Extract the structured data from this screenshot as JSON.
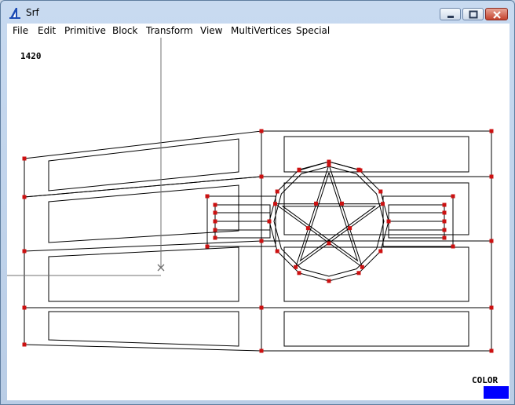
{
  "window": {
    "title": "Srf"
  },
  "menu": [
    "File",
    "Edit",
    "Primitive",
    "Block",
    "Transform",
    "View",
    "MultiVertices",
    "Special"
  ],
  "canvas": {
    "readout": "1420",
    "color_label": "COLOR",
    "current_color": "#0000ff"
  },
  "colors": {
    "vertex": "#cc1111",
    "line": "#000000",
    "cursor": "#707070"
  },
  "icons": {
    "app": "srf-app-icon",
    "minimize": "minimize-icon",
    "maximize": "maximize-icon",
    "close": "close-icon"
  }
}
